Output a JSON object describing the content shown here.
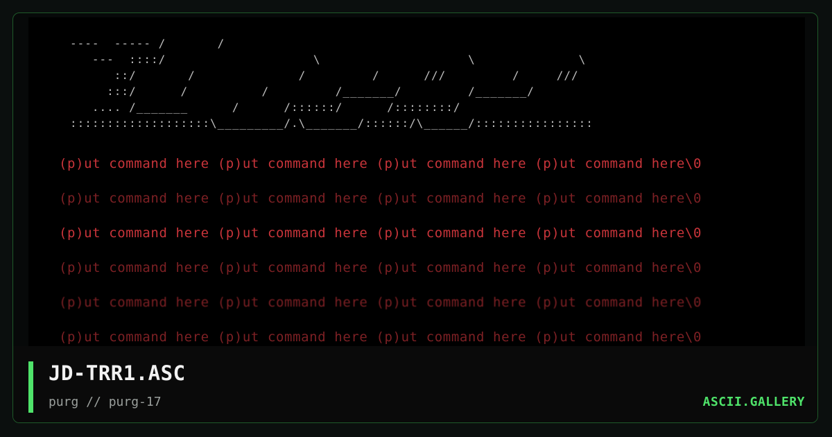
{
  "art": {
    "header_lines": [
      "----  ----- /       /",
      "   ---  ::::/                    \\                    \\              \\",
      "      ::/       /              /         /      ///         /     ///",
      "     :::/      /          /         /_______/         /_______/",
      "   .... /_______      /      /::::::/      /::::::::/",
      ":::::::::::::::::::\\_________/.\\_______/::::::/\\______/::::::::::::::::"
    ],
    "command_rows": [
      "(p)ut command here (p)ut command here (p)ut command here (p)ut command here\\0",
      "(p)ut command here (p)ut command here (p)ut command here (p)ut command here\\0",
      "(p)ut command here (p)ut command here (p)ut command here (p)ut command here\\0",
      "(p)ut command here (p)ut command here (p)ut command here (p)ut command here\\0",
      "(p)ut command here (p)ut command here (p)ut command here (p)ut command here\\0",
      "(p)ut command here (p)ut command here (p)ut command here (p)ut command here\\0"
    ],
    "colors": {
      "command_text": "#c8343a",
      "header_text": "#bdbdbd",
      "background": "#000000"
    }
  },
  "info": {
    "title": "JD-TRR1.ASC",
    "byline": "purg // purg-17",
    "brand": "ASCII.GALLERY",
    "accent_color": "#4fe36a"
  }
}
